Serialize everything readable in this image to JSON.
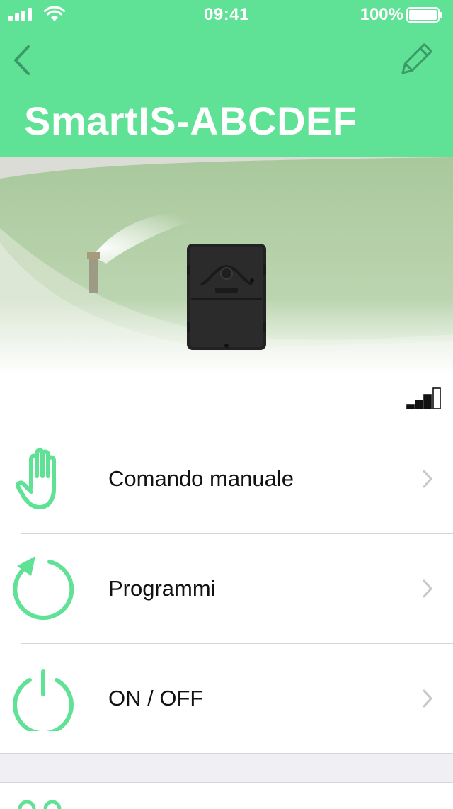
{
  "status_bar": {
    "time": "09:41",
    "battery_label": "100%",
    "battery_level": 1.0
  },
  "header": {
    "title": "SmartIS-ABCDEF",
    "back_icon": "chevron-left-icon",
    "edit_icon": "pencil-icon",
    "color": "#5fe196"
  },
  "device": {
    "signal_icon": "signal-strength-icon",
    "signal_bars_filled": 3,
    "signal_bars_total": 4
  },
  "menu": {
    "items": [
      {
        "label": "Comando manuale",
        "icon": "hand-icon"
      },
      {
        "label": "Programmi",
        "icon": "refresh-icon"
      },
      {
        "label": "ON / OFF",
        "icon": "power-icon"
      }
    ]
  },
  "colors": {
    "accent": "#5fe196",
    "icon_green": "#5fe196",
    "chevron": "#c7c7cc"
  }
}
